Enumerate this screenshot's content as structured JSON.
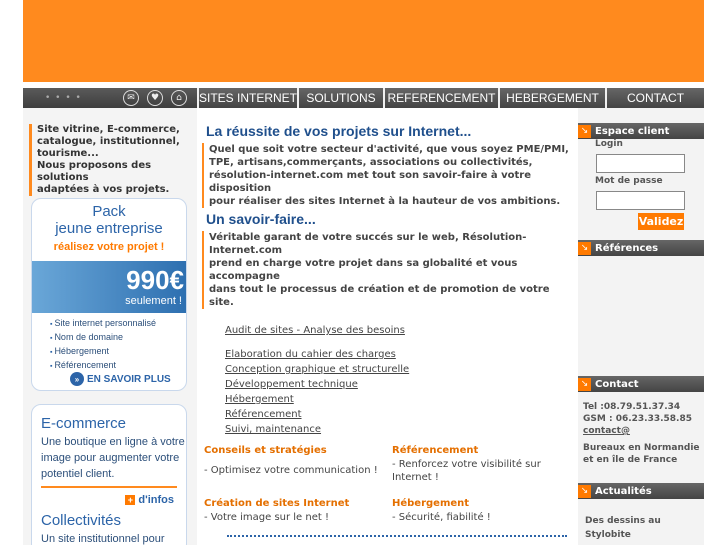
{
  "nav": {
    "tool_dots": "• • • •",
    "items": [
      "SITES INTERNET",
      "SOLUTIONS",
      "REFERENCEMENT",
      "HEBERGEMENT",
      "CONTACT"
    ]
  },
  "left": {
    "intro": [
      "Site vitrine, E-commerce,",
      "catalogue, institutionnel,",
      "tourisme...",
      "Nous proposons des solutions",
      "adaptées à vos projets."
    ],
    "pack": {
      "title_line1": "Pack",
      "title_line2": "jeune entreprise",
      "subtitle": "réalisez votre projet !",
      "price": "990€",
      "price_note": "seulement !",
      "features": [
        "Site internet personnalisé",
        "Nom de domaine",
        "Hébergement",
        "Référencement"
      ],
      "more": "EN SAVOIR PLUS"
    },
    "ecommerce": {
      "title": "E-commerce",
      "text": "Une boutique en ligne à votre image pour augmenter votre potentiel client.",
      "infos": "d'infos"
    },
    "collectivites": {
      "title": "Collectivités",
      "text": "Un site institutionnel pour"
    }
  },
  "main": {
    "heading1": "La réussite de vos projets sur Internet...",
    "para1": [
      "Quel que soit votre secteur d'activité, que vous soyez PME/PMI,",
      "TPE, artisans,commerçants, associations ou collectivités,",
      "résolution-internet.com met tout son savoir-faire à votre",
      "disposition",
      "pour réaliser des sites Internet à la hauteur de vos ambitions."
    ],
    "heading2": "Un savoir-faire...",
    "para2": [
      "Véritable garant de votre succés sur le web, Résolution-",
      "Internet.com",
      "prend en charge votre projet dans sa globalité et vous",
      "accompagne",
      "dans tout le processus de création et de promotion de votre",
      "site."
    ],
    "links": [
      "Audit de sites - Analyse des besoins",
      "Elaboration du cahier des charges",
      "Conception graphique et structurelle",
      "Développement technique",
      "Hébergement",
      "Référencement",
      "Suivi, maintenance"
    ],
    "services": [
      {
        "title": "Conseils et stratégies",
        "text": "- Optimisez votre communication !"
      },
      {
        "title": "Référencement",
        "text": "- Renforcez votre visibilité sur Internet !"
      },
      {
        "title": "Création de sites Internet",
        "text": "- Votre image sur le net !"
      },
      {
        "title": "Hébergement",
        "text": "- Sécurité, fiabilité !"
      }
    ]
  },
  "right": {
    "client": {
      "title": "Espace client",
      "login_label": "Login",
      "password_label": "Mot de passe",
      "submit": "Validez"
    },
    "references": {
      "title": "Références"
    },
    "contact": {
      "title": "Contact",
      "tel": "Tel :08.79.51.37.34",
      "gsm": "GSM : 06.23.33.58.85",
      "email_link": "contact@",
      "office": "Bureaux en Normandie et en île de France"
    },
    "news": {
      "title": "Actualités",
      "text": "Des dessins au Stylobite"
    }
  }
}
